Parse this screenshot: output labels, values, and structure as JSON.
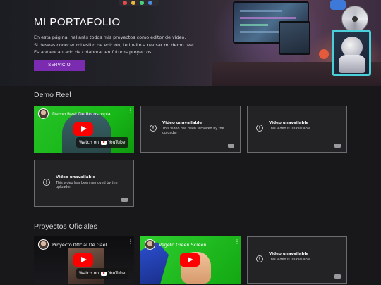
{
  "hero": {
    "title": "MI PORTAFOLIO",
    "lines": [
      "En esta página, hallarás todos mis proyectos como editor de video.",
      "Si deseas conocer mi estilo de edición, te invito a revisar mi demo reel.",
      "Estaré encantado de colaborar en futuros proyectos."
    ],
    "button_label": "SERVICIO"
  },
  "demo_reel": {
    "title": "Demo Reel",
    "videos": [
      {
        "type": "playable",
        "title": "Demo Reel De Rotoscopia",
        "watch_label": "Watch on",
        "yt_label": "YouTube"
      },
      {
        "type": "unavailable",
        "title": "Video unavailable",
        "subtitle": "This video has been removed by the uploader"
      },
      {
        "type": "unavailable",
        "title": "Video unavailable",
        "subtitle": "This video is unavailable"
      },
      {
        "type": "unavailable",
        "title": "Video unavailable",
        "subtitle": "This video has been removed by the uploader"
      }
    ]
  },
  "proyectos": {
    "title": "Proyectos Oficiales",
    "videos": [
      {
        "type": "playable",
        "title": "Proyecto Oficial De Gael ...",
        "watch_label": "Watch on",
        "yt_label": "YouTube"
      },
      {
        "type": "playable",
        "title": "Vegeto Green Screen"
      },
      {
        "type": "unavailable",
        "title": "Video unavailable",
        "subtitle": "This video is unavailable"
      }
    ]
  },
  "colors": {
    "accent": "#7b2bb0",
    "background": "#18181b",
    "youtube_red": "#ff0000"
  }
}
